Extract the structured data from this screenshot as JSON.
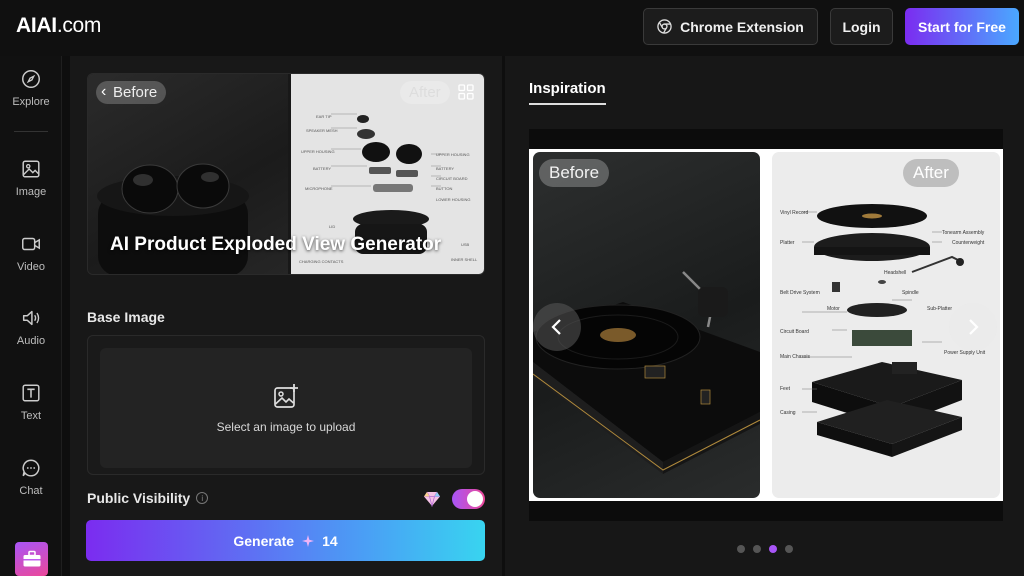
{
  "header": {
    "logo": "AIAI",
    "logo_suffix": ".com",
    "chrome_extension_label": "Chrome Extension",
    "login_label": "Login",
    "start_label": "Start for Free"
  },
  "nav": {
    "items": [
      {
        "label": "Explore",
        "icon": "compass-icon"
      },
      {
        "label": "Image",
        "icon": "image-icon"
      },
      {
        "label": "Video",
        "icon": "video-icon"
      },
      {
        "label": "Audio",
        "icon": "speaker-icon"
      },
      {
        "label": "Text",
        "icon": "text-icon"
      },
      {
        "label": "Chat",
        "icon": "chat-icon"
      }
    ],
    "bottom_icon": "briefcase-icon"
  },
  "tool": {
    "before_label": "Before",
    "after_label": "After",
    "title": "AI Product Exploded View Generator",
    "hero_parts": [
      "EAR TIP",
      "SPEAKER MESH",
      "UPPER HOUSING",
      "BATTERY",
      "MICROPHONE",
      "LID",
      "CHARGING CONTACTS",
      "UPPER HOUSING",
      "BATTERY",
      "CIRCUIT BOARD",
      "BUTTON",
      "LOWER HOUSING",
      "USB",
      "INNER SHELL"
    ],
    "base_image_label": "Base Image",
    "upload_text": "Select an image to upload",
    "visibility_label": "Public Visibility",
    "visibility_on": true,
    "generate_label": "Generate",
    "generate_cost": "14"
  },
  "inspiration": {
    "tab_label": "Inspiration",
    "before_label": "Before",
    "after_label": "After",
    "parts": [
      "Vinyl Record",
      "Platter",
      "Tonearm Assembly",
      "Counterweight",
      "Headshell",
      "Belt Drive System",
      "Spindle",
      "Motor",
      "Sub-Platter",
      "Circuit Board",
      "Main Chassis",
      "Power Supply Unit",
      "Feet",
      "Casing"
    ],
    "slide_count": 4,
    "active_slide": 3
  },
  "colors": {
    "accent_purple": "#7b2cf0",
    "accent_blue": "#4aa8ff",
    "accent_pink": "#ec4899"
  }
}
